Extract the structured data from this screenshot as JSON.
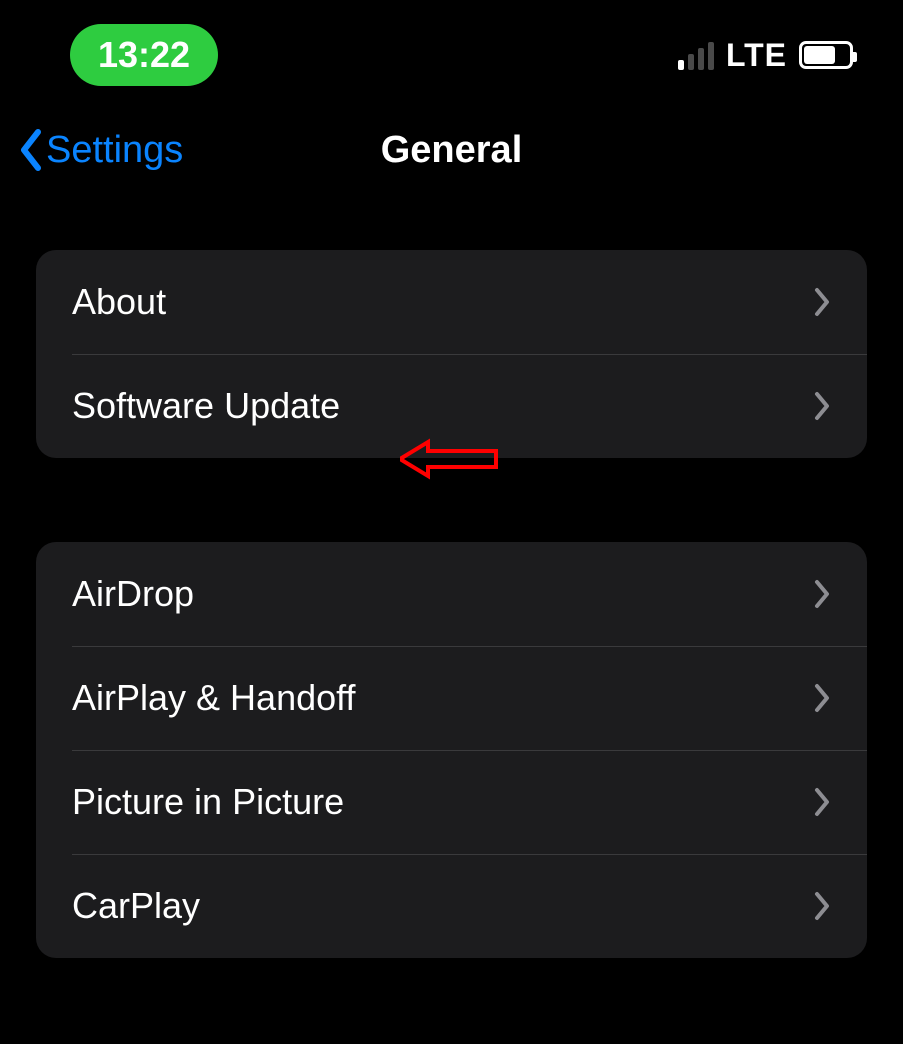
{
  "status_bar": {
    "time": "13:22",
    "network_type": "LTE"
  },
  "nav": {
    "back_label": "Settings",
    "title": "General"
  },
  "sections": [
    {
      "id": "section-info",
      "rows": [
        {
          "id": "about",
          "label": "About"
        },
        {
          "id": "software-update",
          "label": "Software Update"
        }
      ]
    },
    {
      "id": "section-connectivity",
      "rows": [
        {
          "id": "airdrop",
          "label": "AirDrop"
        },
        {
          "id": "airplay-handoff",
          "label": "AirPlay & Handoff"
        },
        {
          "id": "picture-in-picture",
          "label": "Picture in Picture"
        },
        {
          "id": "carplay",
          "label": "CarPlay"
        }
      ]
    }
  ],
  "annotation": {
    "target_row": "software-update",
    "color": "#ff0000"
  }
}
